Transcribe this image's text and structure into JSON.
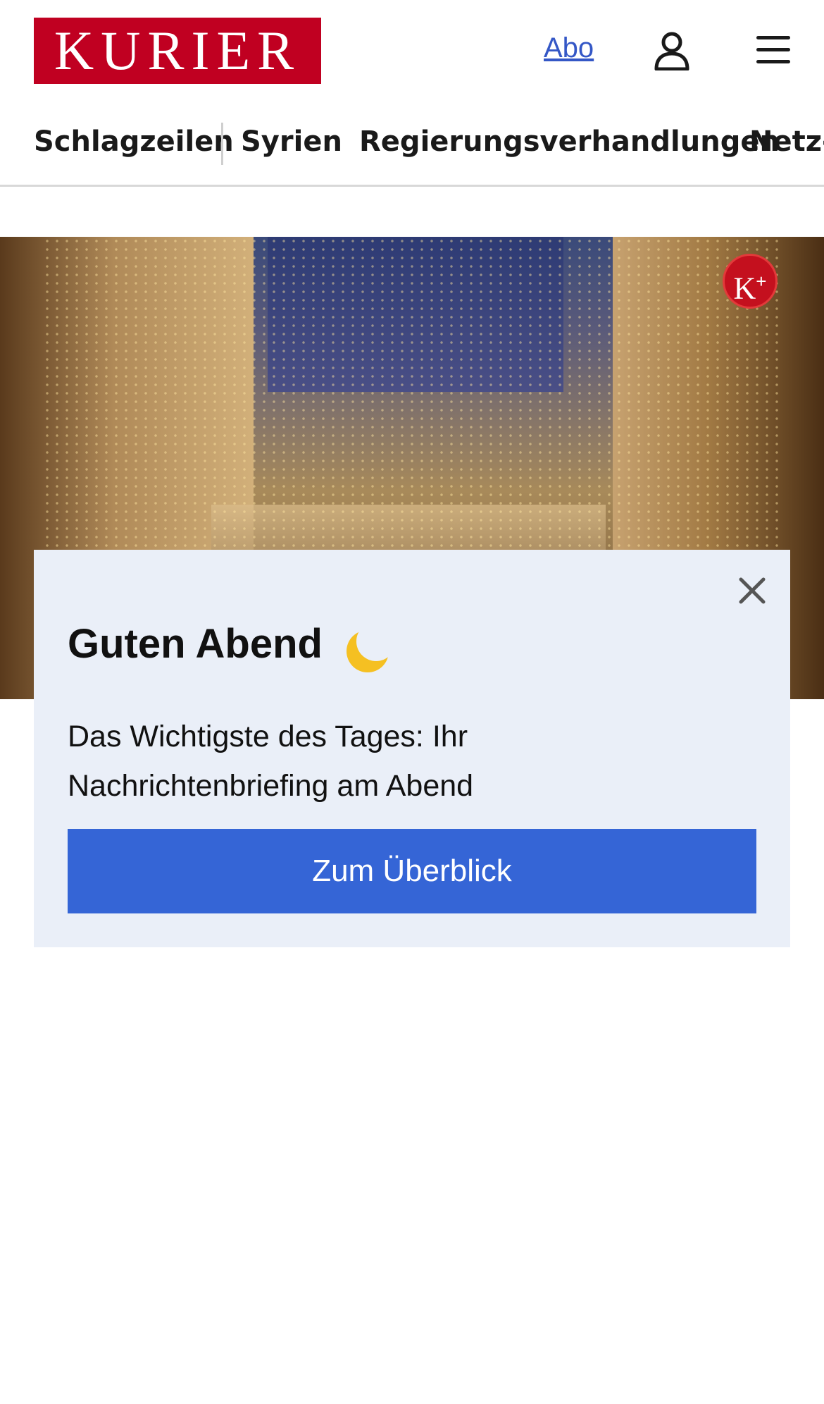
{
  "header": {
    "logo_text": "KURIER",
    "abo_label": "Abo",
    "user_icon": "user-icon",
    "menu_icon": "hamburger-menu-icon",
    "brand_color": "#c00021"
  },
  "nav": {
    "items": [
      {
        "label": "Schlagzeilen"
      },
      {
        "label": "Syrien"
      },
      {
        "label": "Regierungsverhandlungen"
      },
      {
        "label": "Netz-"
      }
    ]
  },
  "hero": {
    "badge_text": "K",
    "badge_sup": "+",
    "badge_color": "#c4101e"
  },
  "popup": {
    "greeting": "Guten Abend",
    "greeting_icon": "crescent-moon-icon",
    "subtext": "Das Wichtigste des Tages: Ihr Nachrichtenbriefing am Abend",
    "cta_label": "Zum Überblick",
    "cta_color": "#3565d6",
    "background": "#eaeff8",
    "close_icon": "close-icon"
  }
}
